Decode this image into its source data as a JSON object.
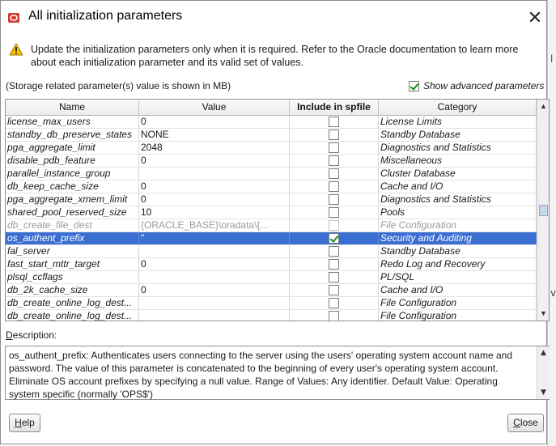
{
  "dialog": {
    "title": "All initialization parameters"
  },
  "warning": {
    "text": "Update the initialization parameters only when it is required. Refer to the Oracle documentation to learn more about each initialization parameter and its valid set of values."
  },
  "storage_note": "(Storage related parameter(s) value is shown in MB)",
  "show_advanced": {
    "label": "Show advanced parameters",
    "checked": true
  },
  "table": {
    "columns": [
      "Name",
      "Value",
      "Include in spfile",
      "Category"
    ],
    "rows": [
      {
        "name": "license_max_users",
        "value": "0",
        "category": "License Limits",
        "included": false,
        "state": "normal"
      },
      {
        "name": "standby_db_preserve_states",
        "value": "NONE",
        "category": "Standby Database",
        "included": false,
        "state": "normal"
      },
      {
        "name": "pga_aggregate_limit",
        "value": "2048",
        "category": "Diagnostics and Statistics",
        "included": false,
        "state": "normal"
      },
      {
        "name": "disable_pdb_feature",
        "value": "0",
        "category": "Miscellaneous",
        "included": false,
        "state": "normal"
      },
      {
        "name": "parallel_instance_group",
        "value": "",
        "category": "Cluster Database",
        "included": false,
        "state": "normal"
      },
      {
        "name": "db_keep_cache_size",
        "value": "0",
        "category": "Cache and I/O",
        "included": false,
        "state": "normal"
      },
      {
        "name": "pga_aggregate_xmem_limit",
        "value": "0",
        "category": "Diagnostics and Statistics",
        "included": false,
        "state": "normal"
      },
      {
        "name": "shared_pool_reserved_size",
        "value": "10",
        "category": "Pools",
        "included": false,
        "state": "normal"
      },
      {
        "name": "db_create_file_dest",
        "value": "{ORACLE_BASE}\\oradata\\{...",
        "category": "File Configuration",
        "included": false,
        "state": "disabled"
      },
      {
        "name": "os_authent_prefix",
        "value": "\"",
        "category": "Security and Auditing",
        "included": true,
        "state": "selected"
      },
      {
        "name": "fal_server",
        "value": "",
        "category": "Standby Database",
        "included": false,
        "state": "normal"
      },
      {
        "name": "fast_start_mttr_target",
        "value": "0",
        "category": "Redo Log and Recovery",
        "included": false,
        "state": "normal"
      },
      {
        "name": "plsql_ccflags",
        "value": "",
        "category": "PL/SQL",
        "included": false,
        "state": "normal"
      },
      {
        "name": "db_2k_cache_size",
        "value": "0",
        "category": "Cache and I/O",
        "included": false,
        "state": "normal"
      },
      {
        "name": "db_create_online_log_dest...",
        "value": "",
        "category": "File Configuration",
        "included": false,
        "state": "normal"
      },
      {
        "name": "db_create_online_log_dest...",
        "value": "",
        "category": "File Configuration",
        "included": false,
        "state": "normal"
      }
    ]
  },
  "description": {
    "label": "Description:",
    "text": "os_authent_prefix: Authenticates users connecting to the server using the users' operating system account name and password. The value of this parameter is concatenated to the beginning of every user's operating system account. Eliminate OS account prefixes by specifying a null value. Range of Values: Any identifier. Default Value: Operating system specific (normally 'OPS$')"
  },
  "buttons": {
    "help": "Help",
    "close": "Close"
  },
  "colors": {
    "selection": "#3a6fd1",
    "checkmark": "#1f8a1f",
    "warning": "#f2c200"
  },
  "icons": {
    "app": "oracle-app-icon",
    "warning": "warning-icon",
    "close": "close-icon"
  }
}
